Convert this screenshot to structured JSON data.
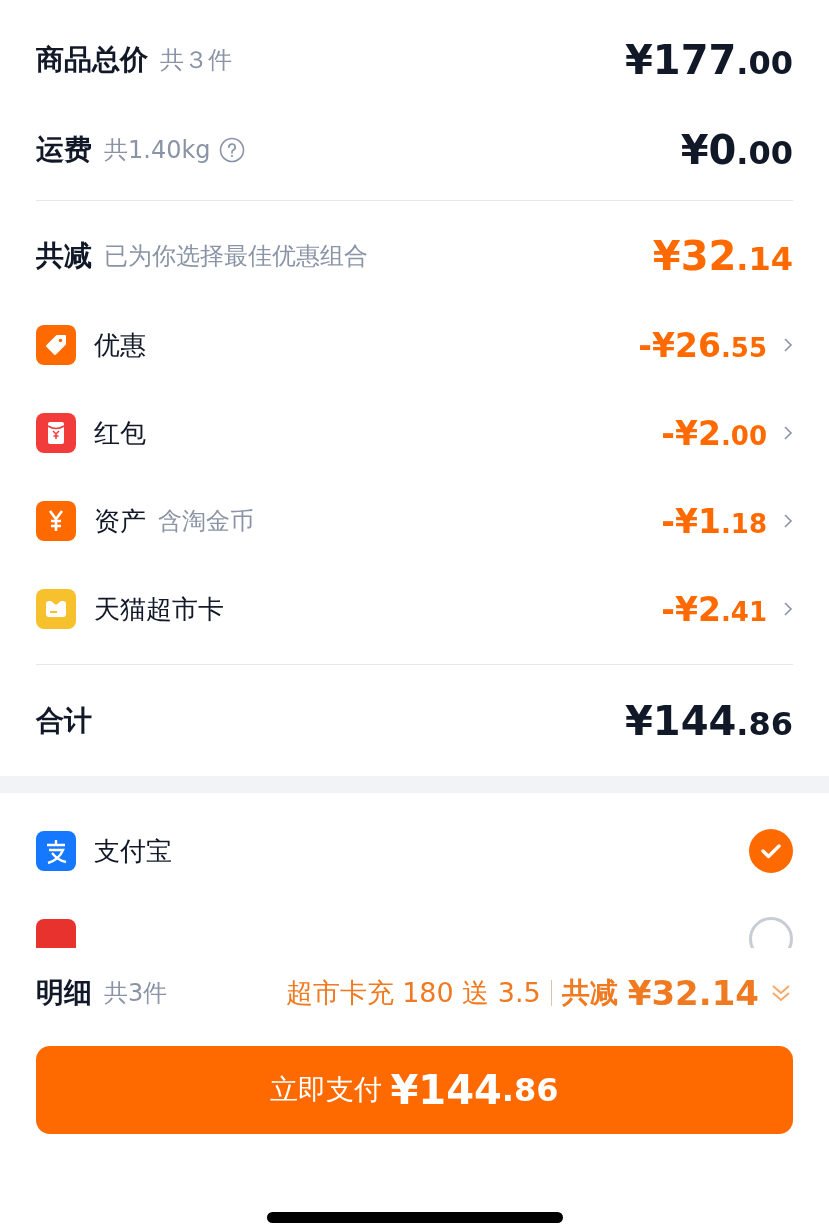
{
  "summary": [
    {
      "label": "商品总价",
      "note": "共３件",
      "help": false,
      "main": "¥177",
      "decimal": ".00"
    },
    {
      "label": "运费",
      "note": "共1.40kg",
      "help": true,
      "main": "¥0",
      "decimal": ".00"
    }
  ],
  "discount": {
    "label": "共减",
    "note": "已为你选择最佳优惠组合",
    "main": "¥32",
    "decimal": ".14",
    "items": [
      {
        "kind": "tag",
        "label": "优惠",
        "main": "-¥26",
        "decimal": ".55",
        "color": "#ff6a00"
      },
      {
        "kind": "envelope",
        "label": "红包",
        "main": "-¥2",
        "decimal": ".00",
        "color": "#f23c3c"
      },
      {
        "kind": "coin",
        "label": "资产",
        "note": "含淘金币",
        "main": "-¥1",
        "decimal": ".18",
        "color": "#ff6a00"
      },
      {
        "kind": "card",
        "label": "天猫超市卡",
        "main": "-¥2",
        "decimal": ".41",
        "color": "#f7c12e"
      }
    ]
  },
  "total": {
    "label": "合计",
    "main": "¥144",
    "decimal": ".86"
  },
  "payments": [
    {
      "kind": "alipay",
      "label": "支付宝",
      "selected": true
    },
    {
      "kind": "unionpay",
      "selected": false
    }
  ],
  "footer": {
    "label": "明细",
    "note": "共3件",
    "promo": "超市卡充 180 送 3.5",
    "saving_label": "共减",
    "saving": "¥32.14"
  },
  "pay_button": {
    "label": "立即支付",
    "main": "¥144",
    "decimal": ".86"
  }
}
